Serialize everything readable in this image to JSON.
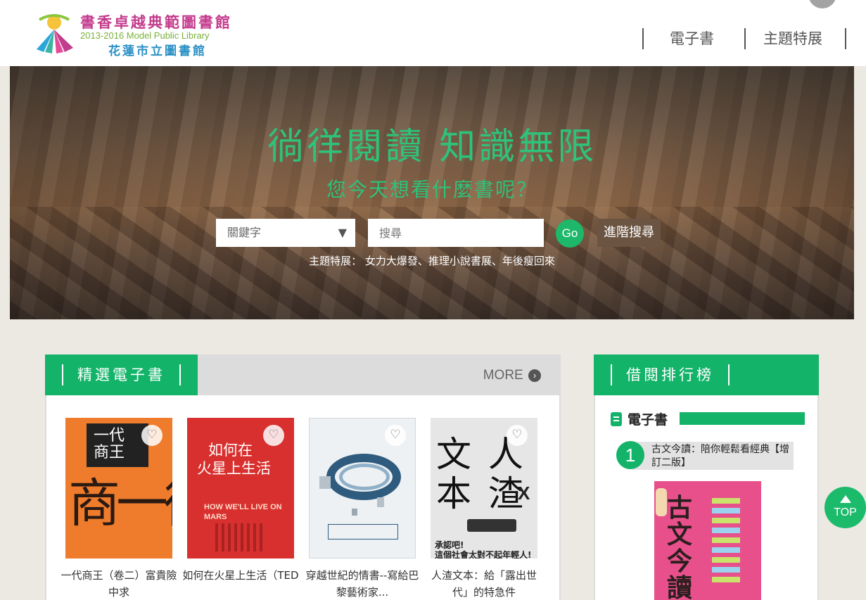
{
  "header": {
    "logo_title": "書香卓越典範圖書館",
    "logo_subtitle": "2013-2016 Model Public Library",
    "logo_name": "花蓮市立圖書館",
    "nav": [
      "電子書",
      "主題特展"
    ]
  },
  "hero": {
    "title": "徜徉閱讀 知識無限",
    "subtitle": "您今天想看什麼書呢？",
    "search_type": "關鍵字",
    "search_placeholder": "搜尋",
    "go_label": "Go",
    "advanced_label": "進階搜尋",
    "topics_text": "主題特展： 女力大爆發、推理小說書展、年後瘦回來"
  },
  "featured": {
    "title": "精選電子書",
    "more_label": "MORE",
    "books": [
      {
        "title": "一代商王（卷二）富貴險中求",
        "cover_text": "一代商王",
        "cover_big": "商一術"
      },
      {
        "title": "如何在火星上生活（TED",
        "cover_text_1": "如何在",
        "cover_text_2": "火星上生活",
        "cover_text_3": "HOW WE'LL LIVE ON MARS"
      },
      {
        "title": "穿越世紀的情書--寫給巴黎藝術家..."
      },
      {
        "title": "人渣文本：給「露出世代」的特急件",
        "cover_text_1": "文 人",
        "cover_text_2": "本 渣",
        "cover_x": "X",
        "cover_slogan": "承認吧!\n這個社會太對不起年輕人!"
      }
    ]
  },
  "ranking": {
    "title": "借閱排行榜",
    "section": "電子書",
    "items": [
      {
        "rank": "1",
        "title": "古文今讀：陪你輕鬆看經典【增訂二版】",
        "cover_text": "古文今讀"
      }
    ]
  },
  "top_button": {
    "label": "TOP"
  }
}
